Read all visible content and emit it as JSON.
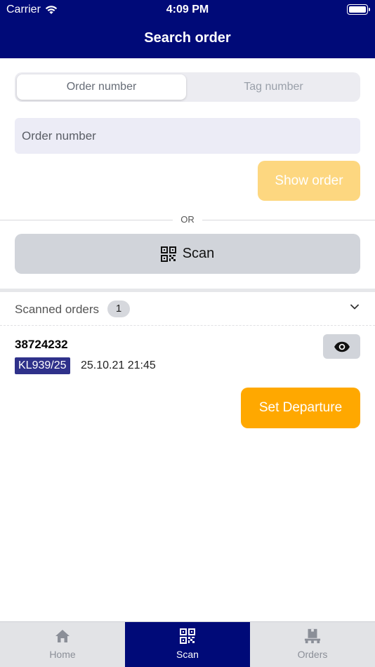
{
  "status_bar": {
    "carrier": "Carrier",
    "time": "4:09 PM"
  },
  "header": {
    "title": "Search order"
  },
  "segment": {
    "options": [
      "Order number",
      "Tag number"
    ],
    "selected": "Order number"
  },
  "search": {
    "placeholder": "Order number",
    "value": ""
  },
  "show_order": {
    "label": "Show order"
  },
  "or_label": "OR",
  "scan": {
    "label": "Scan"
  },
  "scanned": {
    "title": "Scanned orders",
    "count": "1",
    "items": [
      {
        "order_number": "38724232",
        "flight": "KL939/25",
        "datetime": "25.10.21 21:45"
      }
    ]
  },
  "set_departure": {
    "label": "Set Departure"
  },
  "tabbar": {
    "items": [
      {
        "label": "Home",
        "icon": "home-icon"
      },
      {
        "label": "Scan",
        "icon": "qr-code-icon",
        "active": true
      },
      {
        "label": "Orders",
        "icon": "pallet-box-icon"
      }
    ]
  },
  "colors": {
    "header": "#000a78",
    "accent": "#ffa800",
    "accent_disabled": "#fdd780",
    "flight_badge": "#2f318a"
  }
}
